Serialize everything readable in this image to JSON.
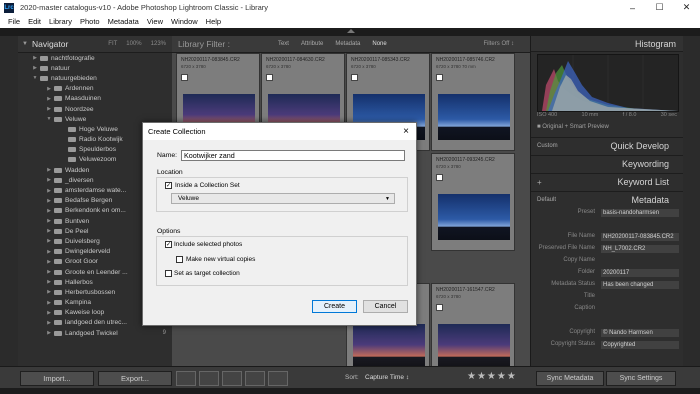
{
  "window": {
    "title": "2020-master catalogus-v10 - Adobe Photoshop Lightroom Classic - Library",
    "app_icon": "Lrc"
  },
  "menu": [
    "File",
    "Edit",
    "Library",
    "Photo",
    "Metadata",
    "View",
    "Window",
    "Help"
  ],
  "navigator": {
    "title": "Navigator",
    "options": [
      "FIT",
      "100%",
      "123%"
    ]
  },
  "folders": [
    {
      "label": "nachtfotografie",
      "count": "",
      "level": 1,
      "expanded": false
    },
    {
      "label": "natuur",
      "count": "",
      "level": 1,
      "expanded": false
    },
    {
      "label": "natuurgebieden",
      "count": "",
      "level": 1,
      "expanded": true
    },
    {
      "label": "Ardennen",
      "count": "",
      "level": 2,
      "expanded": false
    },
    {
      "label": "Maasduinen",
      "count": "",
      "level": 2,
      "expanded": false
    },
    {
      "label": "Noordzee",
      "count": "",
      "level": 2,
      "expanded": false
    },
    {
      "label": "Veluwe",
      "count": "",
      "level": 2,
      "expanded": true
    },
    {
      "label": "Hoge Veluwe",
      "count": "",
      "level": 3,
      "expanded": false
    },
    {
      "label": "Radio Kootwijk",
      "count": "",
      "level": 3,
      "expanded": false
    },
    {
      "label": "Speulderbos",
      "count": "",
      "level": 3,
      "expanded": false
    },
    {
      "label": "Veluwezoom",
      "count": "",
      "level": 3,
      "expanded": false
    },
    {
      "label": "Wadden",
      "count": "",
      "level": 2,
      "expanded": false
    },
    {
      "label": "_diversen",
      "count": "",
      "level": 2,
      "expanded": false
    },
    {
      "label": "amsterdamse wate...",
      "count": "",
      "level": 2,
      "expanded": false
    },
    {
      "label": "Bedafse Bergen",
      "count": "",
      "level": 2,
      "expanded": false
    },
    {
      "label": "Berkendonk en om...",
      "count": "",
      "level": 2,
      "expanded": false
    },
    {
      "label": "Buntven",
      "count": "",
      "level": 2,
      "expanded": false
    },
    {
      "label": "De Peel",
      "count": "",
      "level": 2,
      "expanded": false
    },
    {
      "label": "Duivelsberg",
      "count": "",
      "level": 2,
      "expanded": false
    },
    {
      "label": "Dwingelderveld",
      "count": "",
      "level": 2,
      "expanded": false
    },
    {
      "label": "Groot Goor",
      "count": "",
      "level": 2,
      "expanded": false
    },
    {
      "label": "Groote en Leender ...",
      "count": "",
      "level": 2,
      "expanded": false
    },
    {
      "label": "Hallerbos",
      "count": "",
      "level": 2,
      "expanded": false
    },
    {
      "label": "Herbertusbossen",
      "count": "",
      "level": 2,
      "expanded": false
    },
    {
      "label": "Kampina",
      "count": "72",
      "level": 2,
      "expanded": false
    },
    {
      "label": "Kaweise loop",
      "count": "351",
      "level": 2,
      "expanded": false
    },
    {
      "label": "landgoed den utrec...",
      "count": "15",
      "level": 2,
      "expanded": false
    },
    {
      "label": "Landgoed Twickel",
      "count": "9",
      "level": 2,
      "expanded": false
    }
  ],
  "filter_bar": {
    "title": "Library Filter :",
    "options": [
      "Text",
      "Attribute",
      "Metadata",
      "None"
    ],
    "filters_off": "Filters Off ↕"
  },
  "thumbnails": [
    {
      "filename": "NH20200117-083845.CR2",
      "dims": "6720 x 3780",
      "sky": "dusk"
    },
    {
      "filename": "NH20200117-084630.CR2",
      "dims": "6720 x 3780",
      "sky": "dusk"
    },
    {
      "filename": "NH20200117-085343.CR2",
      "dims": "6720 x 3780",
      "sky": "blue"
    },
    {
      "filename": "NH20200117-085746.CR2",
      "dims": "6720 x 3780  70 mm",
      "sky": "blue"
    },
    {
      "filename": "",
      "dims": "",
      "sky": "blue"
    },
    {
      "filename": "NH20200117-093245.CR2",
      "dims": "6720 x 3780",
      "sky": "blue"
    },
    {
      "filename": "NH20200117-161518.RAF",
      "dims": "",
      "sky": "dusk"
    },
    {
      "filename": "NH20200117-161547.CR2",
      "dims": "6720 x 3780",
      "sky": "dusk"
    }
  ],
  "right_panel": {
    "histogram_title": "Histogram",
    "histo_info": {
      "iso": "ISO 400",
      "focal": "10 mm",
      "aperture": "f / 8.0",
      "shutter": "30 sec"
    },
    "original": "Original + Smart Preview",
    "quick_develop": {
      "preset_tag": "Custom",
      "label": "Quick Develop"
    },
    "keywording": "Keywording",
    "keyword_list": {
      "plus": "+",
      "label": "Keyword List"
    },
    "metadata": {
      "preset_tag": "Default",
      "label": "Metadata"
    },
    "meta_rows": [
      {
        "label": "Preset",
        "value": "basis-nandoharmsen",
        "box": true
      },
      {
        "label": "",
        "value": "",
        "box": false
      },
      {
        "label": "File Name",
        "value": "NH20200117-083845.CR2",
        "box": true
      },
      {
        "label": "Preserved File Name",
        "value": "NH_L7002.CR2",
        "box": true
      },
      {
        "label": "Copy Name",
        "value": "",
        "box": false
      },
      {
        "label": "Folder",
        "value": "20200117",
        "box": true
      },
      {
        "label": "Metadata Status",
        "value": "Has been changed",
        "box": true
      },
      {
        "label": "Title",
        "value": "",
        "box": false
      },
      {
        "label": "Caption",
        "value": "",
        "box": false
      },
      {
        "label": "",
        "value": "",
        "box": false
      },
      {
        "label": "Copyright",
        "value": "© Nando Harmsen",
        "box": true
      },
      {
        "label": "Copyright Status",
        "value": "Copyrighted",
        "box": true
      }
    ]
  },
  "toolbar": {
    "import": "Import...",
    "export": "Export...",
    "sort_label": "Sort:",
    "sort_value": "Capture Time ↕",
    "stars": "★★★★★",
    "sync_metadata": "Sync Metadata",
    "sync_settings": "Sync Settings"
  },
  "dialog": {
    "title": "Create Collection",
    "close": "×",
    "name_label": "Name:",
    "name_value": "Kootwijker zand",
    "location_label": "Location",
    "inside_set_label": "Inside a Collection Set",
    "inside_set_checked": true,
    "set_value": "Veluwe",
    "options_label": "Options",
    "include_selected_label": "Include selected photos",
    "include_selected_checked": true,
    "virtual_copies_label": "Make new virtual copies",
    "virtual_copies_checked": false,
    "target_label": "Set as target collection",
    "target_checked": false,
    "create_label": "Create",
    "cancel_label": "Cancel"
  },
  "colors": {
    "accent": "#0078d7",
    "panel": "#2e2e2e",
    "grid": "#4a4a4a"
  }
}
